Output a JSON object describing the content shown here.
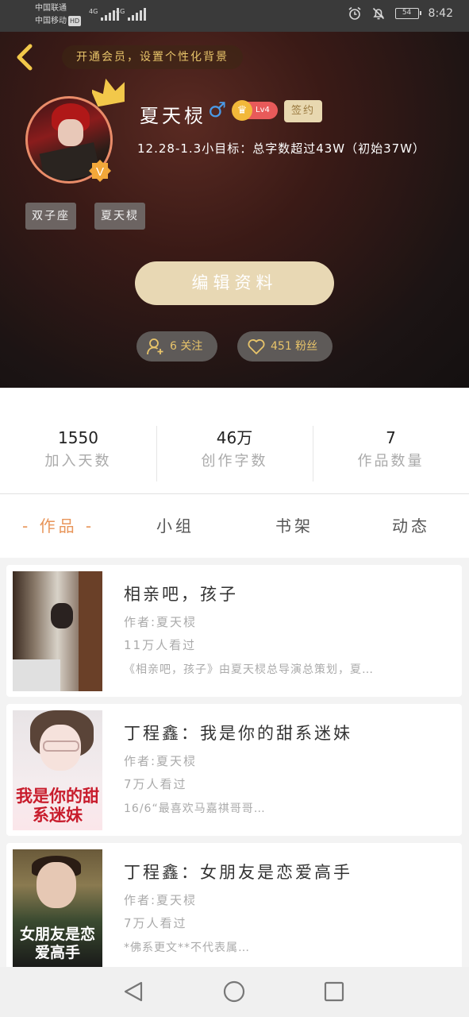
{
  "status_bar": {
    "carrier1": "中国联通",
    "carrier2": "中国移动",
    "hd": "HD",
    "network1": "4G",
    "network2": "4G",
    "battery": "54",
    "time": "8:42"
  },
  "header": {
    "vip_banner": "开通会员，设置个性化背景",
    "username": "夏天棂",
    "gender_symbol": "♂",
    "level": "Lv4",
    "sign_badge": "签约",
    "bio": "12.28-1.3小目标：总字数超过43W（初始37W）",
    "tags": [
      "双子座",
      "夏天棂"
    ],
    "edit_button": "编辑资料",
    "following": "6 关注",
    "fans": "451 粉丝",
    "colors": {
      "accent": "#e8c46a",
      "edit_button": "#e8d8b4",
      "avatar_ring": "#e98c69"
    }
  },
  "stats": [
    {
      "value": "1550",
      "label": "加入天数"
    },
    {
      "value": "46万",
      "label": "创作字数"
    },
    {
      "value": "7",
      "label": "作品数量"
    }
  ],
  "tabs": [
    {
      "label": "- 作品 -",
      "active": true
    },
    {
      "label": "小组",
      "active": false
    },
    {
      "label": "书架",
      "active": false
    },
    {
      "label": "动态",
      "active": false
    }
  ],
  "books": [
    {
      "title": "相亲吧，孩子",
      "author": "作者:夏天棂",
      "views": "11万人看过",
      "desc": "《相亲吧，孩子》由夏天棂总导演总策划，夏…",
      "cover_text": ""
    },
    {
      "title": "丁程鑫：我是你的甜系迷妹",
      "author": "作者:夏天棂",
      "views": "7万人看过",
      "desc": "16/6“最喜欢马嘉祺哥哥…",
      "cover_text": "我是你的甜系迷妹"
    },
    {
      "title": "丁程鑫：女朋友是恋爱高手",
      "author": "作者:夏天棂",
      "views": "7万人看过",
      "desc": "*佛系更文**不代表属…",
      "cover_text": "女朋友是恋爱高手"
    }
  ],
  "icons": {
    "back": "chevron-left-icon",
    "crown": "crown-icon",
    "verified": "v-badge-icon",
    "following": "add-user-icon",
    "fans": "heart-icon",
    "nav_back": "triangle-back-icon",
    "nav_home": "circle-home-icon",
    "nav_recent": "square-recent-icon"
  }
}
